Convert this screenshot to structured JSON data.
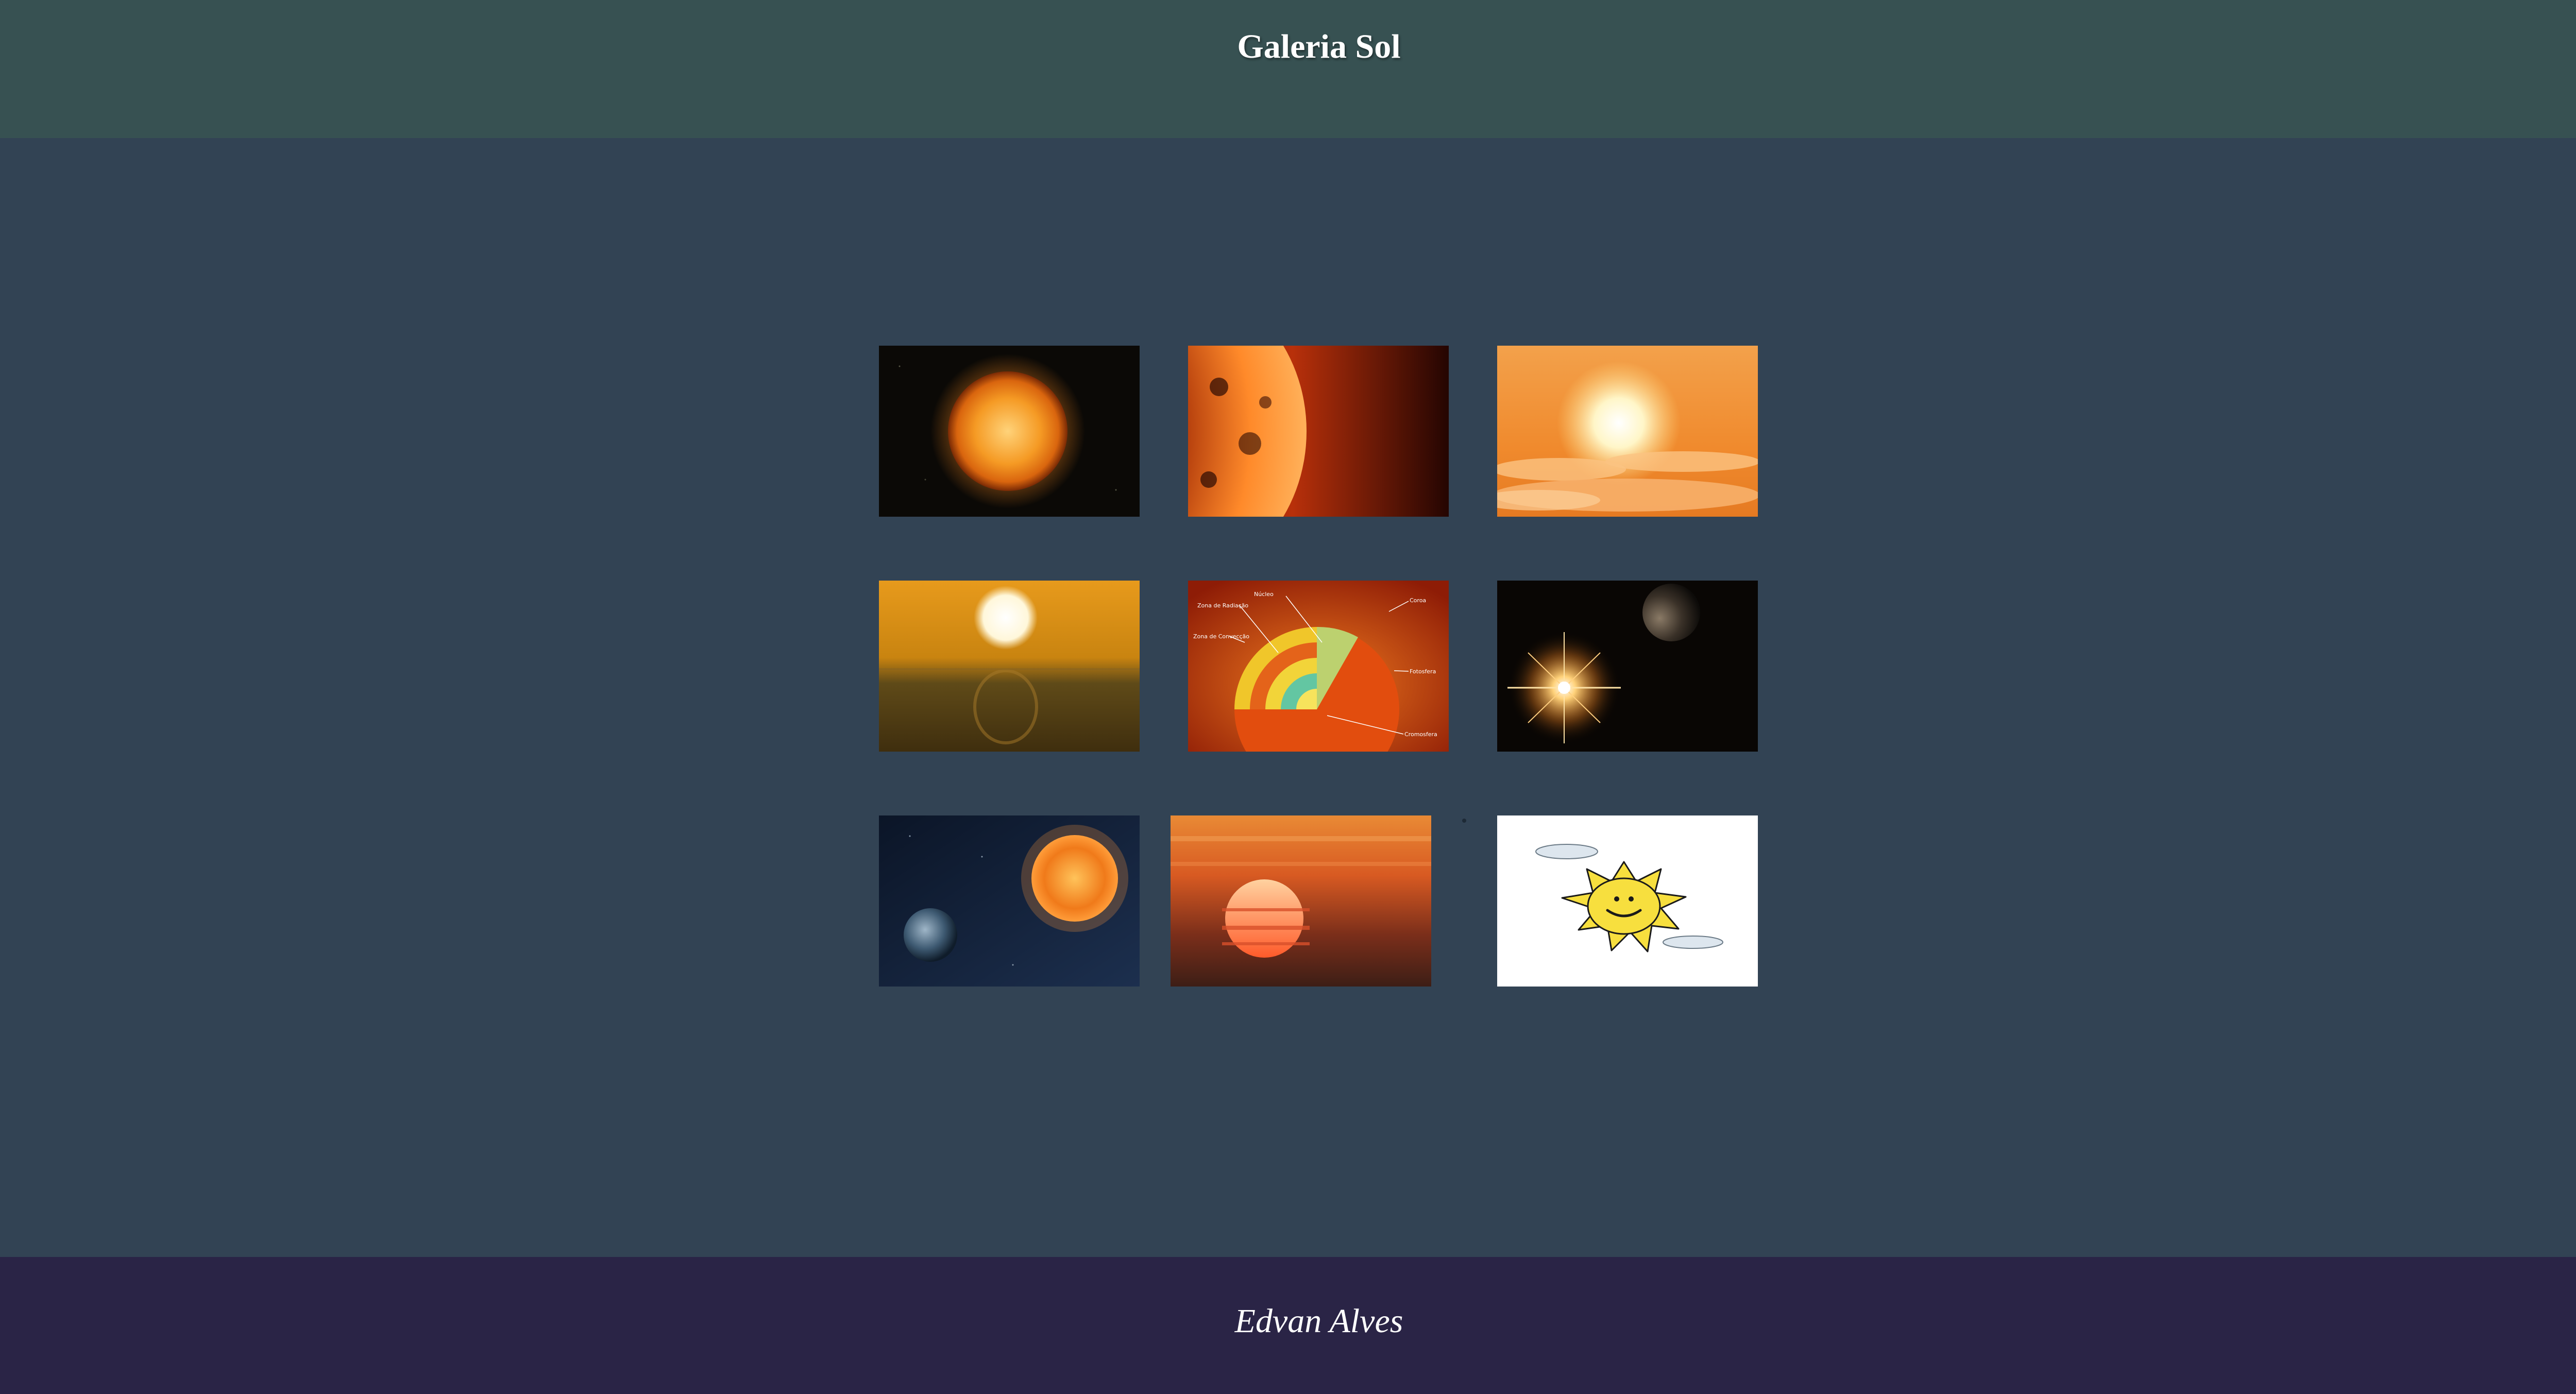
{
  "header": {
    "title": "Galeria Sol"
  },
  "gallery": {
    "images": [
      {
        "name": "sun-in-space-photo"
      },
      {
        "name": "sun-surface-closeup-photo"
      },
      {
        "name": "sun-over-clouds-photo"
      },
      {
        "name": "sunset-reflection-photo"
      },
      {
        "name": "sun-structure-diagram-photo",
        "labels": [
          "Núcleo",
          "Zona de Radiação",
          "Zona de Convecção",
          "Coroa",
          "Fotosfera",
          "Cromosfera"
        ]
      },
      {
        "name": "star-flare-and-planet-photo"
      },
      {
        "name": "sun-and-earth-photo"
      },
      {
        "name": "red-sunset-photo"
      },
      {
        "name": "cartoon-sun-drawing"
      }
    ]
  },
  "footer": {
    "author": "Edvan Alves"
  }
}
